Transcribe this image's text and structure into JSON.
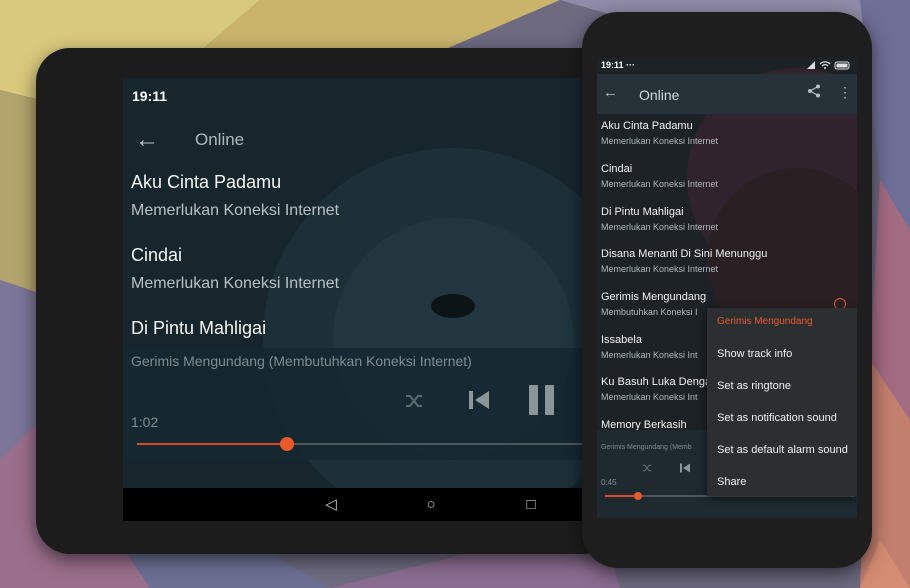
{
  "tablet": {
    "status_time": "19:11",
    "title": "Online",
    "songs": [
      {
        "name": "Aku Cinta Padamu",
        "status": "Memerlukan Koneksi Internet"
      },
      {
        "name": "Cindai",
        "status": "Memerlukan Koneksi Internet"
      },
      {
        "name": "Di Pintu Mahligai",
        "status": ""
      }
    ],
    "now_playing": "Gerimis Mengundang (Membutuhkan Koneksi Internet)",
    "elapsed": "1:02",
    "progress": 0.33
  },
  "phone": {
    "status_time": "19:11",
    "status_dots": "···",
    "title": "Online",
    "songs": [
      {
        "name": "Aku Cinta Padamu",
        "status": "Memerlukan Koneksi Internet"
      },
      {
        "name": "Cindai",
        "status": "Memerlukan Koneksi Internet"
      },
      {
        "name": "Di Pintu Mahligai",
        "status": "Memerlukan Koneksi Internet"
      },
      {
        "name": "Disana Menanti Di Sini Menunggu",
        "status": "Memerlukan Koneksi Internet"
      },
      {
        "name": "Gerimis Mengundang",
        "status": "Membutuhkan Koneksi I"
      },
      {
        "name": "Issabela",
        "status": "Memerlukan Koneksi Int"
      },
      {
        "name": "Ku Basuh Luka Denga",
        "status": "Memerlukan Koneksi Int"
      },
      {
        "name": "Memory Berkasih",
        "status": ""
      }
    ],
    "now_playing": "Gerimis Mengundang (Memb",
    "elapsed": "0:45",
    "progress": 0.13,
    "menu": {
      "header": "Gerimis Mengundang",
      "items": [
        "Show track info",
        "Set as ringtone",
        "Set as notification sound",
        "Set as default alarm sound",
        "Share"
      ]
    }
  },
  "colors": {
    "accent": "#e65a2a",
    "appbar": "#263238",
    "screen": "#152228"
  }
}
